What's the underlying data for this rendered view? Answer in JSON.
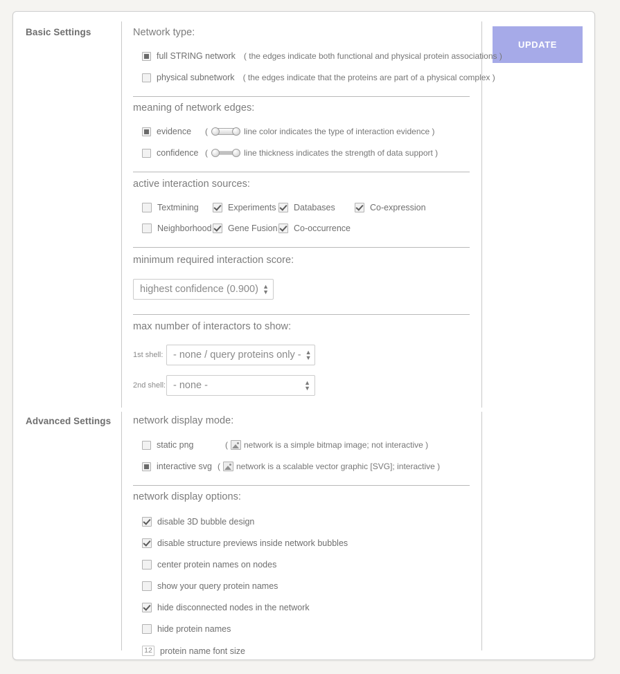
{
  "sections": {
    "basic_label": "Basic Settings",
    "advanced_label": "Advanced Settings"
  },
  "update_button": {
    "label": "UPDATE",
    "color": "#a6aae8"
  },
  "network_type": {
    "title": "Network type:",
    "options": [
      {
        "label": "full STRING network",
        "desc": "( the edges indicate both functional and physical protein associations )",
        "selected": true
      },
      {
        "label": "physical subnetwork",
        "desc": "( the edges indicate that the proteins are part of a physical complex )",
        "selected": false
      }
    ]
  },
  "network_edges": {
    "title": "meaning of network edges:",
    "options": [
      {
        "label": "evidence",
        "desc_open": "(",
        "desc": "line color indicates the type of interaction evidence )",
        "icon": "thick-edge-icon",
        "selected": true
      },
      {
        "label": "confidence",
        "desc_open": "(",
        "desc": "line thickness indicates the strength of data support )",
        "icon": "thin-edge-icon",
        "selected": false
      }
    ]
  },
  "interaction_sources": {
    "title": "active interaction sources:",
    "row1": [
      {
        "label": "Textmining",
        "checked": false
      },
      {
        "label": "Experiments",
        "checked": true
      },
      {
        "label": "Databases",
        "checked": true
      },
      {
        "label": "Co-expression",
        "checked": true
      }
    ],
    "row2": [
      {
        "label": "Neighborhood",
        "checked": false
      },
      {
        "label": "Gene Fusion",
        "checked": true
      },
      {
        "label": "Co-occurrence",
        "checked": true
      }
    ]
  },
  "min_score": {
    "title": "minimum required interaction score:",
    "value": "highest confidence (0.900)"
  },
  "interactors": {
    "title": "max number of interactors to show:",
    "shell1_label": "1st shell:",
    "shell1_value": "- none / query proteins only -",
    "shell2_label": "2nd shell:",
    "shell2_value": "- none -"
  },
  "display_mode": {
    "title": "network display mode:",
    "options": [
      {
        "label": "static png",
        "desc_open": "(",
        "desc": "network is a simple bitmap image; not interactive )",
        "selected": false
      },
      {
        "label": "interactive svg",
        "desc_open": "(",
        "desc": "network is a scalable vector graphic [SVG]; interactive )",
        "selected": true
      }
    ]
  },
  "display_options": {
    "title": "network display options:",
    "items": [
      {
        "label": "disable 3D bubble design",
        "checked": true
      },
      {
        "label": "disable structure previews inside network bubbles",
        "checked": true
      },
      {
        "label": "center protein names on nodes",
        "checked": false
      },
      {
        "label": "show your query protein names",
        "checked": false
      },
      {
        "label": "hide disconnected nodes in the network",
        "checked": true
      },
      {
        "label": "hide protein names",
        "checked": false
      }
    ],
    "font_size_value": "12",
    "font_size_label": "protein name font size"
  }
}
